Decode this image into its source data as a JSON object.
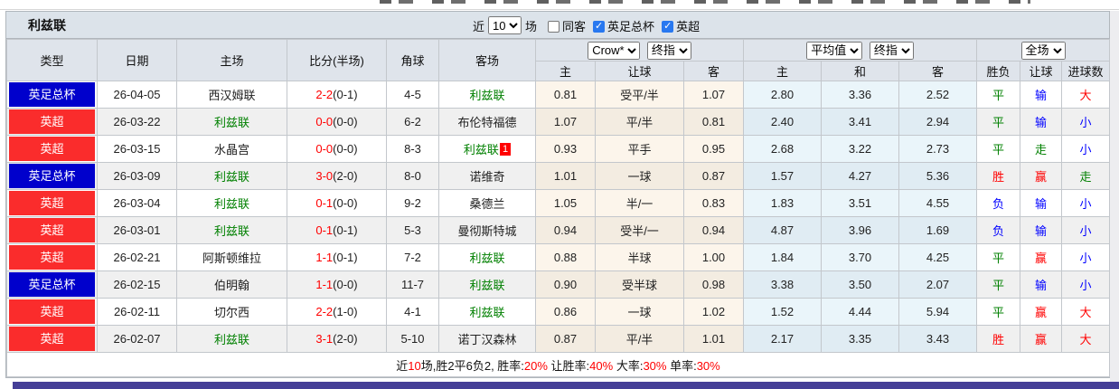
{
  "title": "利兹联",
  "filter": {
    "recent_prefix": "近",
    "recent_value": "10",
    "recent_suffix": "场",
    "checkboxes": [
      {
        "label": "同客",
        "checked": false
      },
      {
        "label": "英足总杯",
        "checked": true
      },
      {
        "label": "英超",
        "checked": true
      }
    ]
  },
  "table": {
    "columns_left": [
      "类型",
      "日期",
      "主场",
      "比分(半场)",
      "角球",
      "客场"
    ],
    "selects": {
      "odds_provider": "Crow*",
      "odds_stage": "终指",
      "avg_provider": "平均值",
      "avg_stage": "终指",
      "scope": "全场"
    },
    "sub_columns": [
      "主",
      "让球",
      "客",
      "主",
      "和",
      "客",
      "胜负",
      "让球",
      "进球数"
    ],
    "rows": [
      {
        "league": "英足总杯",
        "league_type": "cup",
        "date": "26-04-05",
        "home": "西汉姆联",
        "home_hl": false,
        "score": "2-2",
        "half": "(0-1)",
        "corners": "4-5",
        "away": "利兹联",
        "away_hl": true,
        "away_sup": "",
        "odds_home": "0.81",
        "handicap": "受平/半",
        "odds_away": "1.07",
        "avg_home": "2.80",
        "avg_draw": "3.36",
        "avg_away": "2.52",
        "result": "平",
        "handicap_result": "输",
        "goals_result": "大"
      },
      {
        "league": "英超",
        "league_type": "epl",
        "date": "26-03-22",
        "home": "利兹联",
        "home_hl": true,
        "score": "0-0",
        "half": "(0-0)",
        "corners": "6-2",
        "away": "布伦特福德",
        "away_hl": false,
        "away_sup": "",
        "odds_home": "1.07",
        "handicap": "平/半",
        "odds_away": "0.81",
        "avg_home": "2.40",
        "avg_draw": "3.41",
        "avg_away": "2.94",
        "result": "平",
        "handicap_result": "输",
        "goals_result": "小"
      },
      {
        "league": "英超",
        "league_type": "epl",
        "date": "26-03-15",
        "home": "水晶宫",
        "home_hl": false,
        "score": "0-0",
        "half": "(0-0)",
        "corners": "8-3",
        "away": "利兹联",
        "away_hl": true,
        "away_sup": "1",
        "odds_home": "0.93",
        "handicap": "平手",
        "odds_away": "0.95",
        "avg_home": "2.68",
        "avg_draw": "3.22",
        "avg_away": "2.73",
        "result": "平",
        "handicap_result": "走",
        "goals_result": "小"
      },
      {
        "league": "英足总杯",
        "league_type": "cup",
        "date": "26-03-09",
        "home": "利兹联",
        "home_hl": true,
        "score": "3-0",
        "half": "(2-0)",
        "corners": "8-0",
        "away": "诺维奇",
        "away_hl": false,
        "away_sup": "",
        "odds_home": "1.01",
        "handicap": "一球",
        "odds_away": "0.87",
        "avg_home": "1.57",
        "avg_draw": "4.27",
        "avg_away": "5.36",
        "result": "胜",
        "handicap_result": "赢",
        "goals_result": "走"
      },
      {
        "league": "英超",
        "league_type": "epl",
        "date": "26-03-04",
        "home": "利兹联",
        "home_hl": true,
        "score": "0-1",
        "half": "(0-0)",
        "corners": "9-2",
        "away": "桑德兰",
        "away_hl": false,
        "away_sup": "",
        "odds_home": "1.05",
        "handicap": "半/一",
        "odds_away": "0.83",
        "avg_home": "1.83",
        "avg_draw": "3.51",
        "avg_away": "4.55",
        "result": "负",
        "handicap_result": "输",
        "goals_result": "小"
      },
      {
        "league": "英超",
        "league_type": "epl",
        "date": "26-03-01",
        "home": "利兹联",
        "home_hl": true,
        "score": "0-1",
        "half": "(0-1)",
        "corners": "5-3",
        "away": "曼彻斯特城",
        "away_hl": false,
        "away_sup": "",
        "odds_home": "0.94",
        "handicap": "受半/一",
        "odds_away": "0.94",
        "avg_home": "4.87",
        "avg_draw": "3.96",
        "avg_away": "1.69",
        "result": "负",
        "handicap_result": "输",
        "goals_result": "小"
      },
      {
        "league": "英超",
        "league_type": "epl",
        "date": "26-02-21",
        "home": "阿斯顿维拉",
        "home_hl": false,
        "score": "1-1",
        "half": "(0-1)",
        "corners": "7-2",
        "away": "利兹联",
        "away_hl": true,
        "away_sup": "",
        "odds_home": "0.88",
        "handicap": "半球",
        "odds_away": "1.00",
        "avg_home": "1.84",
        "avg_draw": "3.70",
        "avg_away": "4.25",
        "result": "平",
        "handicap_result": "赢",
        "goals_result": "小"
      },
      {
        "league": "英足总杯",
        "league_type": "cup",
        "date": "26-02-15",
        "home": "伯明翰",
        "home_hl": false,
        "score": "1-1",
        "half": "(0-0)",
        "corners": "11-7",
        "away": "利兹联",
        "away_hl": true,
        "away_sup": "",
        "odds_home": "0.90",
        "handicap": "受半球",
        "odds_away": "0.98",
        "avg_home": "3.38",
        "avg_draw": "3.50",
        "avg_away": "2.07",
        "result": "平",
        "handicap_result": "输",
        "goals_result": "小"
      },
      {
        "league": "英超",
        "league_type": "epl",
        "date": "26-02-11",
        "home": "切尔西",
        "home_hl": false,
        "score": "2-2",
        "half": "(1-0)",
        "corners": "4-1",
        "away": "利兹联",
        "away_hl": true,
        "away_sup": "",
        "odds_home": "0.86",
        "handicap": "一球",
        "odds_away": "1.02",
        "avg_home": "1.52",
        "avg_draw": "4.44",
        "avg_away": "5.94",
        "result": "平",
        "handicap_result": "赢",
        "goals_result": "大"
      },
      {
        "league": "英超",
        "league_type": "epl",
        "date": "26-02-07",
        "home": "利兹联",
        "home_hl": true,
        "score": "3-1",
        "half": "(2-0)",
        "corners": "5-10",
        "away": "诺丁汉森林",
        "away_hl": false,
        "away_sup": "",
        "odds_home": "0.87",
        "handicap": "平/半",
        "odds_away": "1.01",
        "avg_home": "2.17",
        "avg_draw": "3.35",
        "avg_away": "3.43",
        "result": "胜",
        "handicap_result": "赢",
        "goals_result": "大"
      }
    ],
    "summary_segments": [
      {
        "text": "近",
        "red": false
      },
      {
        "text": "10",
        "red": true
      },
      {
        "text": "场,胜2平6负2, 胜率:",
        "red": false
      },
      {
        "text": "20%",
        "red": true
      },
      {
        "text": " 让胜率:",
        "red": false
      },
      {
        "text": "40%",
        "red": true
      },
      {
        "text": " 大率:",
        "red": false
      },
      {
        "text": "30%",
        "red": true
      },
      {
        "text": " 单率:",
        "red": false
      },
      {
        "text": "30%",
        "red": true
      }
    ]
  },
  "colors": {
    "league_cup": "#0000cc",
    "league_epl": "#fa2c2c",
    "team_highlight": "#008000",
    "score_red": "#ff0000",
    "result_map": {
      "胜": "#ff0000",
      "平": "#008000",
      "负": "#0000ff",
      "赢": "#ff0000",
      "输": "#0000ff",
      "走": "#008000",
      "大": "#ff0000",
      "小": "#0000ff"
    }
  }
}
